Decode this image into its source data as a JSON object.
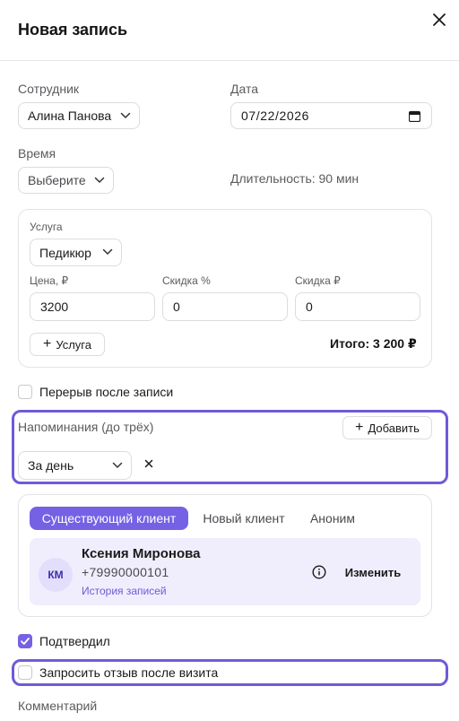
{
  "header": {
    "title": "Новая запись"
  },
  "employee": {
    "label": "Сотрудник",
    "value": "Алина Панова"
  },
  "date": {
    "label": "Дата",
    "value": "07/22/2026"
  },
  "time": {
    "label": "Время",
    "value": "Выберите",
    "duration": "Длительность: 90 мин"
  },
  "service": {
    "label": "Услуга",
    "value": "Педикюр",
    "price_label": "Цена, ₽",
    "price_value": "3200",
    "discount_pct_label": "Скидка %",
    "discount_pct_value": "0",
    "discount_rub_label": "Скидка ₽",
    "discount_rub_value": "0",
    "add_label": "Услуга",
    "total": "Итого: 3 200 ₽"
  },
  "break_after": {
    "label": "Перерыв после записи",
    "checked": false
  },
  "reminders": {
    "label": "Напоминания (до трёх)",
    "add_label": "Добавить",
    "items": [
      {
        "value": "За день"
      }
    ]
  },
  "client": {
    "tabs": [
      {
        "label": "Существующий клиент",
        "active": true
      },
      {
        "label": "Новый клиент",
        "active": false
      },
      {
        "label": "Аноним",
        "active": false
      }
    ],
    "initials": "КМ",
    "name": "Ксения Миронова",
    "phone": "+79990000101",
    "history_link": "История записей",
    "change_label": "Изменить"
  },
  "confirmed": {
    "label": "Подтвердил",
    "checked": true
  },
  "request_review": {
    "label": "Запросить отзыв после визита",
    "checked": false
  },
  "comment": {
    "label": "Комментарий"
  },
  "colors": {
    "accent": "#7561e4",
    "highlight": "#6e5bd8",
    "client_bg": "#f0eefd"
  }
}
